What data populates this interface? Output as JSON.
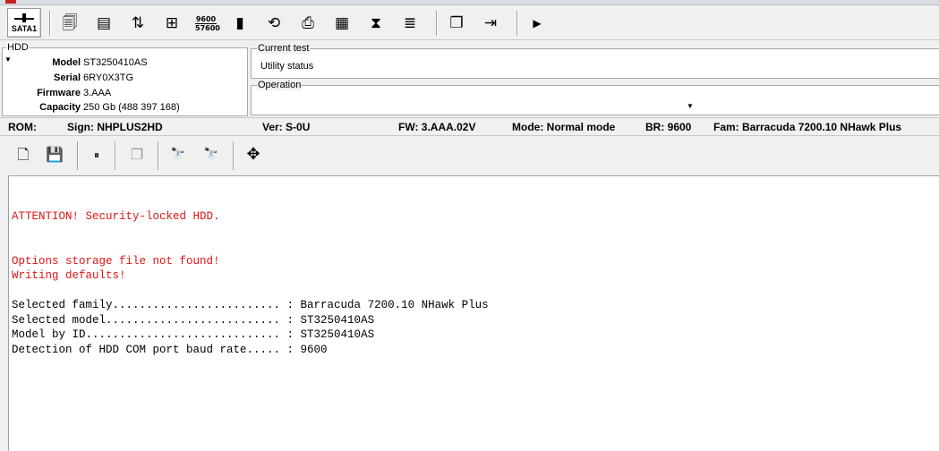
{
  "toolbar": {
    "interface_label": "SATA1",
    "tools": [
      {
        "icon": "hdd-info-icon",
        "glyph": "🗐"
      },
      {
        "icon": "terminal-icon",
        "glyph": "▤"
      },
      {
        "icon": "transfer-icon",
        "glyph": "⇅"
      },
      {
        "icon": "add-drive-icon",
        "glyph": "⊞"
      },
      {
        "icon": "baud-rate-icon",
        "text_top": "9600",
        "text_bottom": "57600"
      },
      {
        "icon": "chip-icon",
        "glyph": "▮"
      },
      {
        "icon": "power-icon",
        "glyph": "⟲"
      },
      {
        "icon": "drive-save-icon",
        "glyph": "⎙"
      },
      {
        "icon": "grid-icon",
        "glyph": "▦"
      },
      {
        "icon": "hourglass-icon",
        "glyph": "⧗"
      },
      {
        "icon": "list-icon",
        "glyph": "≣"
      },
      {
        "icon": "windows-icon",
        "glyph": "❐"
      },
      {
        "icon": "exit-icon",
        "glyph": "⇥"
      },
      {
        "icon": "play-icon",
        "glyph": "▶"
      }
    ]
  },
  "hdd": {
    "legend": "HDD",
    "fields": [
      {
        "label": "Model",
        "value": "ST3250410AS"
      },
      {
        "label": "Serial",
        "value": "6RY0X3TG"
      },
      {
        "label": "Firmware",
        "value": "3.AAA"
      },
      {
        "label": "Capacity",
        "value": "250 Gb (488 397 168)"
      }
    ]
  },
  "current_test": {
    "legend": "Current test",
    "value": "Utility status"
  },
  "operation": {
    "legend": "Operation",
    "value": ""
  },
  "status": {
    "rom": "ROM:",
    "sign": "Sign: NHPLUS2HD",
    "ver": "Ver: S-0U",
    "fw": "FW: 3.AAA.02V",
    "mode": "Mode: Normal mode",
    "br": "BR: 9600",
    "fam": "Fam: Barracuda 7200.10 NHawk Plus"
  },
  "toolbar2": {
    "tools": [
      {
        "icon": "open-file-icon",
        "glyph": "🗋"
      },
      {
        "icon": "save-log-icon",
        "glyph": "💾"
      },
      {
        "icon": "pause-icon",
        "glyph": "⏸"
      },
      {
        "icon": "copy-icon",
        "glyph": "❐"
      },
      {
        "icon": "find-icon",
        "glyph": "🔭"
      },
      {
        "icon": "find-next-icon",
        "glyph": "🔭"
      },
      {
        "icon": "move-icon",
        "glyph": "✥"
      }
    ]
  },
  "log": {
    "lines": [
      {
        "text": "ATTENTION! Security-locked HDD.",
        "color": "#e11414"
      },
      {
        "text": "Options storage file not found!",
        "color": "#e11414"
      },
      {
        "text": "Writing defaults!",
        "color": "#e11414"
      },
      {
        "text": "Selected family......................... : Barracuda 7200.10 NHawk Plus",
        "color": "#000000"
      },
      {
        "text": "Selected model.......................... : ST3250410AS",
        "color": "#000000"
      },
      {
        "text": "Model by ID............................. : ST3250410AS",
        "color": "#000000"
      },
      {
        "text": "Detection of HDD COM port baud rate..... : 9600",
        "color": "#000000"
      }
    ]
  }
}
